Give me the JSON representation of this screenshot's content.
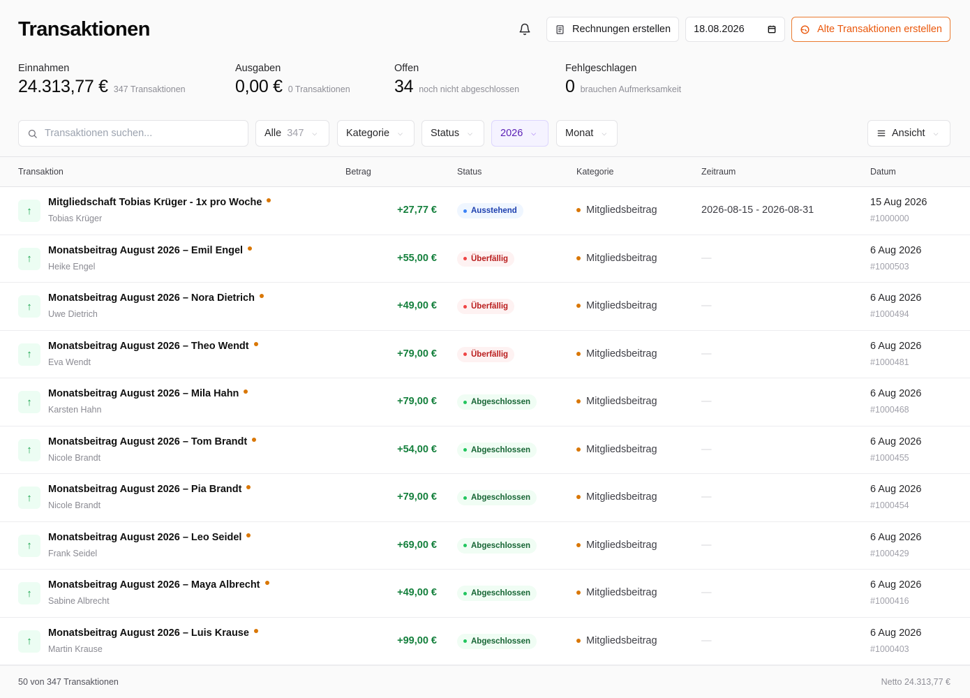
{
  "header": {
    "title": "Transaktionen",
    "invoice_button": "Rechnungen erstellen",
    "date_value": "18.08.2026",
    "old_tx_button": "Alte Transaktionen erstellen"
  },
  "stats": [
    {
      "label": "Einnahmen",
      "value": "24.313,77 €",
      "sub": "347 Transaktionen"
    },
    {
      "label": "Ausgaben",
      "value": "0,00 €",
      "sub": "0 Transaktionen"
    },
    {
      "label": "Offen",
      "value": "34",
      "sub": "noch nicht abgeschlossen"
    },
    {
      "label": "Fehlgeschlagen",
      "value": "0",
      "sub": "brauchen Aufmerksamkeit"
    }
  ],
  "filters": {
    "search_placeholder": "Transaktionen suchen...",
    "all_label": "Alle",
    "all_count": "347",
    "category": "Kategorie",
    "status": "Status",
    "year": "2026",
    "month": "Monat",
    "view": "Ansicht"
  },
  "table": {
    "columns": [
      "Transaktion",
      "Betrag",
      "Status",
      "Kategorie",
      "Zeitraum",
      "Datum"
    ],
    "rows": [
      {
        "title": "Mitgliedschaft Tobias Krüger - 1x pro Woche",
        "sub": "Tobias Krüger",
        "amount": "+27,77 €",
        "status": "Ausstehend",
        "status_type": "pending",
        "category": "Mitgliedsbeitrag",
        "period": "2026-08-15 - 2026-08-31",
        "date": "15 Aug 2026",
        "id": "#1000000"
      },
      {
        "title": "Monatsbeitrag August 2026 – Emil Engel",
        "sub": "Heike Engel",
        "amount": "+55,00 €",
        "status": "Überfällig",
        "status_type": "overdue",
        "category": "Mitgliedsbeitrag",
        "period": "—",
        "date": "6 Aug 2026",
        "id": "#1000503"
      },
      {
        "title": "Monatsbeitrag August 2026 – Nora Dietrich",
        "sub": "Uwe Dietrich",
        "amount": "+49,00 €",
        "status": "Überfällig",
        "status_type": "overdue",
        "category": "Mitgliedsbeitrag",
        "period": "—",
        "date": "6 Aug 2026",
        "id": "#1000494"
      },
      {
        "title": "Monatsbeitrag August 2026 – Theo Wendt",
        "sub": "Eva Wendt",
        "amount": "+79,00 €",
        "status": "Überfällig",
        "status_type": "overdue",
        "category": "Mitgliedsbeitrag",
        "period": "—",
        "date": "6 Aug 2026",
        "id": "#1000481"
      },
      {
        "title": "Monatsbeitrag August 2026 – Mila Hahn",
        "sub": "Karsten Hahn",
        "amount": "+79,00 €",
        "status": "Abgeschlossen",
        "status_type": "done",
        "category": "Mitgliedsbeitrag",
        "period": "—",
        "date": "6 Aug 2026",
        "id": "#1000468"
      },
      {
        "title": "Monatsbeitrag August 2026 – Tom Brandt",
        "sub": "Nicole Brandt",
        "amount": "+54,00 €",
        "status": "Abgeschlossen",
        "status_type": "done",
        "category": "Mitgliedsbeitrag",
        "period": "—",
        "date": "6 Aug 2026",
        "id": "#1000455"
      },
      {
        "title": "Monatsbeitrag August 2026 – Pia Brandt",
        "sub": "Nicole Brandt",
        "amount": "+79,00 €",
        "status": "Abgeschlossen",
        "status_type": "done",
        "category": "Mitgliedsbeitrag",
        "period": "—",
        "date": "6 Aug 2026",
        "id": "#1000454"
      },
      {
        "title": "Monatsbeitrag August 2026 – Leo Seidel",
        "sub": "Frank Seidel",
        "amount": "+69,00 €",
        "status": "Abgeschlossen",
        "status_type": "done",
        "category": "Mitgliedsbeitrag",
        "period": "—",
        "date": "6 Aug 2026",
        "id": "#1000429"
      },
      {
        "title": "Monatsbeitrag August 2026 – Maya Albrecht",
        "sub": "Sabine Albrecht",
        "amount": "+49,00 €",
        "status": "Abgeschlossen",
        "status_type": "done",
        "category": "Mitgliedsbeitrag",
        "period": "—",
        "date": "6 Aug 2026",
        "id": "#1000416"
      },
      {
        "title": "Monatsbeitrag August 2026 – Luis Krause",
        "sub": "Martin Krause",
        "amount": "+99,00 €",
        "status": "Abgeschlossen",
        "status_type": "done",
        "category": "Mitgliedsbeitrag",
        "period": "—",
        "date": "6 Aug 2026",
        "id": "#1000403"
      }
    ]
  },
  "footer": {
    "left": "50 von 347 Transaktionen",
    "right": "Netto 24.313,77 €"
  },
  "icons": {
    "bell": "bell-icon",
    "invoice": "receipt-icon",
    "calendar": "calendar-icon",
    "old_tx": "history-icon",
    "search": "search-icon",
    "view": "list-icon",
    "row": "arrow-up-icon"
  },
  "colors": {
    "accent_orange": "#ea580c",
    "positive": "#15803d",
    "category_dot": "#d97706",
    "year_filter": "#5b21b6"
  }
}
